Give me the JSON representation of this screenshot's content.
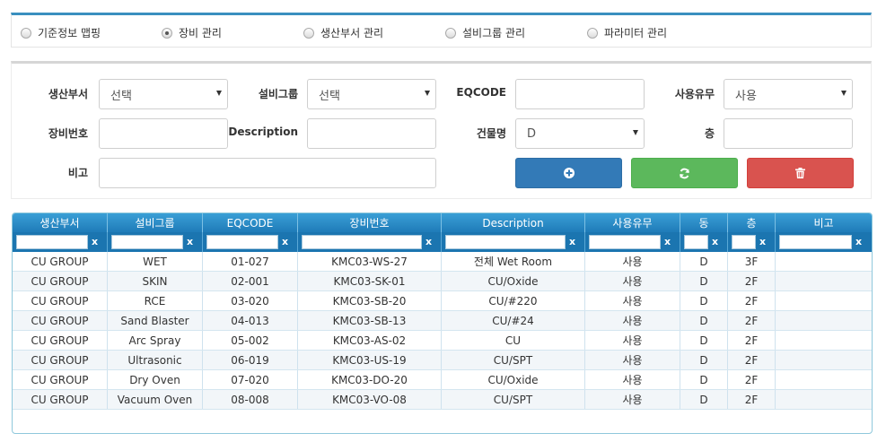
{
  "tabs": [
    {
      "label": "기준정보 맵핑",
      "checked": false
    },
    {
      "label": "장비 관리",
      "checked": true
    },
    {
      "label": "생산부서 관리",
      "checked": false
    },
    {
      "label": "설비그룹 관리",
      "checked": false
    },
    {
      "label": "파라미터 관리",
      "checked": false
    }
  ],
  "form": {
    "dept_label": "생산부서",
    "dept_value": "선택",
    "group_label": "설비그룹",
    "group_value": "선택",
    "eqcode_label": "EQCODE",
    "eqcode_value": "",
    "use_label": "사용유무",
    "use_value": "사용",
    "equip_no_label": "장비번호",
    "equip_no_value": "",
    "description_label": "Description",
    "description_value": "",
    "building_label": "건물명",
    "building_value": "D",
    "floor_label": "층",
    "floor_value": "",
    "remark_label": "비고",
    "remark_value": ""
  },
  "buttons": {
    "add_icon": "plus-circle-icon",
    "refresh_icon": "refresh-icon",
    "delete_icon": "trash-icon",
    "add_color": "#337ab7",
    "refresh_color": "#5cb85c",
    "delete_color": "#d9534f"
  },
  "grid": {
    "columns": [
      "생산부서",
      "설비그룹",
      "EQCODE",
      "장비번호",
      "Description",
      "사용유무",
      "동",
      "층",
      "비고"
    ],
    "filter_clear": "x",
    "rows": [
      [
        "CU GROUP",
        "WET",
        "01-027",
        "KMC03-WS-27",
        "전체 Wet Room",
        "사용",
        "D",
        "3F",
        ""
      ],
      [
        "CU GROUP",
        "SKIN",
        "02-001",
        "KMC03-SK-01",
        "CU/Oxide",
        "사용",
        "D",
        "2F",
        ""
      ],
      [
        "CU GROUP",
        "RCE",
        "03-020",
        "KMC03-SB-20",
        "CU/#220",
        "사용",
        "D",
        "2F",
        ""
      ],
      [
        "CU GROUP",
        "Sand Blaster",
        "04-013",
        "KMC03-SB-13",
        "CU/#24",
        "사용",
        "D",
        "2F",
        ""
      ],
      [
        "CU GROUP",
        "Arc Spray",
        "05-002",
        "KMC03-AS-02",
        "CU",
        "사용",
        "D",
        "2F",
        ""
      ],
      [
        "CU GROUP",
        "Ultrasonic",
        "06-019",
        "KMC03-US-19",
        "CU/SPT",
        "사용",
        "D",
        "2F",
        ""
      ],
      [
        "CU GROUP",
        "Dry Oven",
        "07-020",
        "KMC03-DO-20",
        "CU/Oxide",
        "사용",
        "D",
        "2F",
        ""
      ],
      [
        "CU GROUP",
        "Vacuum Oven",
        "08-008",
        "KMC03-VO-08",
        "CU/SPT",
        "사용",
        "D",
        "2F",
        ""
      ]
    ]
  }
}
